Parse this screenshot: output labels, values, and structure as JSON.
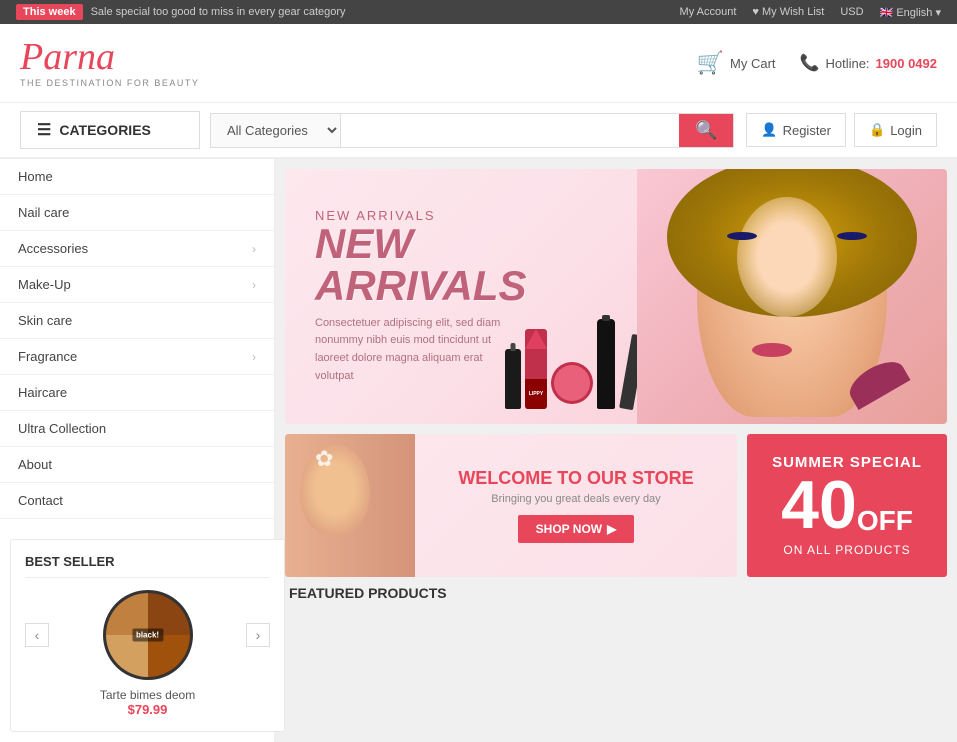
{
  "topbar": {
    "badge": "This week",
    "promo": "Sale special too good to miss in every gear category",
    "account": "My Account",
    "wishlist": "My Wish List",
    "currency": "USD",
    "language": "English"
  },
  "header": {
    "logo": "Parna",
    "tagline": "THE DESTINATION FOR BEAUTY",
    "cart_label": "My Cart",
    "hotline_label": "Hotline:",
    "hotline_number": "1900 0492"
  },
  "nav": {
    "categories_label": "CATEGORIES",
    "search_placeholder": "",
    "all_categories": "All Categories",
    "register": "Register",
    "login": "Login"
  },
  "sidebar": {
    "items": [
      {
        "label": "Home",
        "has_arrow": false
      },
      {
        "label": "Nail care",
        "has_arrow": false
      },
      {
        "label": "Accessories",
        "has_arrow": true
      },
      {
        "label": "Make-Up",
        "has_arrow": true
      },
      {
        "label": "Skin care",
        "has_arrow": false
      },
      {
        "label": "Fragrance",
        "has_arrow": true
      },
      {
        "label": "Haircare",
        "has_arrow": false
      },
      {
        "label": "Ultra Collection",
        "has_arrow": false
      },
      {
        "label": "About",
        "has_arrow": false
      },
      {
        "label": "Contact",
        "has_arrow": false
      }
    ]
  },
  "banner": {
    "new": "NEW",
    "arrivals": "ARRIVALS",
    "description": "Consectetuer adipiscing elit, sed diam nonummy nibh euis mod tincidunt ut laoreet dolore magna aliquam erat volutpat"
  },
  "best_seller": {
    "title": "BEST SELLER",
    "product_name": "Tarte bimes deom",
    "product_price": "$79.99",
    "brand": "black!"
  },
  "welcome": {
    "title": "WELCOME TO OUR STORE",
    "subtitle": "Bringing you great deals every day",
    "shop_now": "SHOP NOW"
  },
  "summer": {
    "title": "SUMMER SPECIAL",
    "percent": "40",
    "off": "OFF",
    "subtitle": "ON ALL PRODUCTS"
  },
  "featured": {
    "label": "FEATURED PRODUCTS"
  }
}
